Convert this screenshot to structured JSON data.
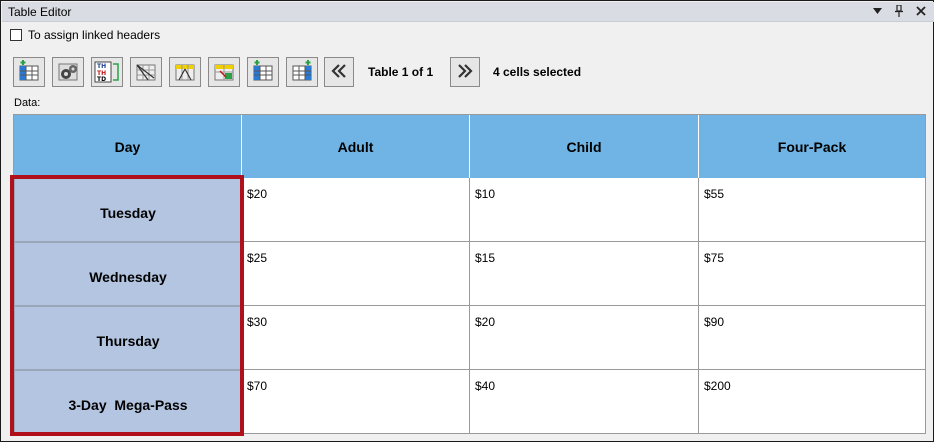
{
  "window": {
    "title": "Table Editor"
  },
  "options": {
    "linked_headers_label": "To assign linked headers"
  },
  "toolbar": {
    "table_indicator": "Table 1 of 1",
    "selection_status": "4 cells selected",
    "icons": [
      "insert-column-icon",
      "settings-gears-icon",
      "th-td-toggle-icon",
      "diagonal-grid-icon",
      "header-split-icon",
      "cell-fill-icon",
      "add-column-icon",
      "add-row-icon"
    ]
  },
  "data_label": "Data:",
  "table": {
    "headers": [
      "Day",
      "Adult",
      "Child",
      "Four-Pack"
    ],
    "rows": [
      {
        "day": "Tuesday",
        "adult": "$20",
        "child": "$10",
        "fourpack": "$55"
      },
      {
        "day": "Wednesday",
        "adult": "$25",
        "child": "$15",
        "fourpack": "$75"
      },
      {
        "day": "Thursday",
        "adult": "$30",
        "child": "$20",
        "fourpack": "$90"
      },
      {
        "day": "3-Day  Mega-Pass",
        "adult": "$70",
        "child": "$40",
        "fourpack": "$200"
      }
    ]
  },
  "colors": {
    "header": "#6fb4e4",
    "row_header": "#b3c5e0",
    "selection": "#b0101a"
  }
}
